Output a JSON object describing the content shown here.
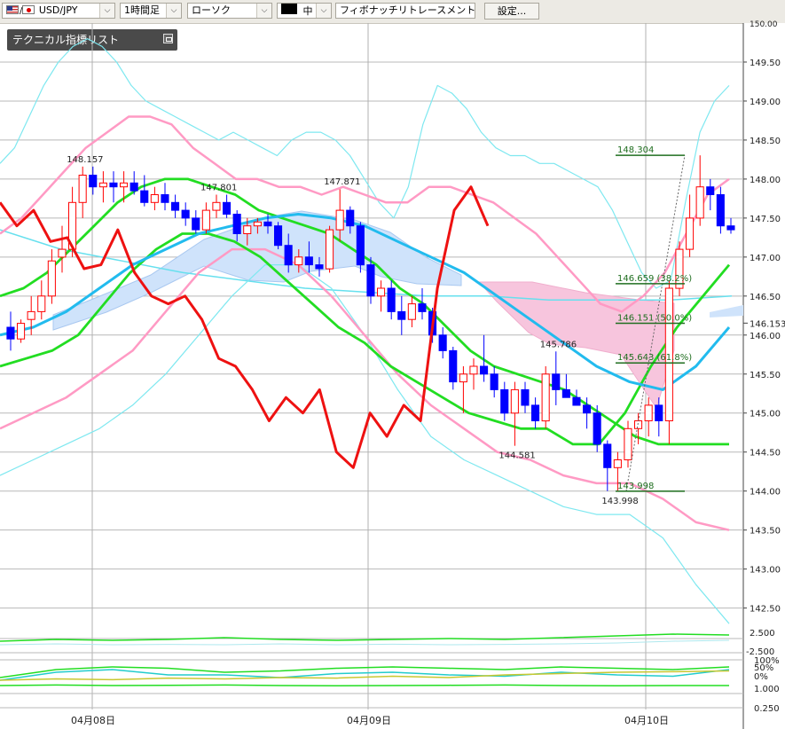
{
  "toolbar": {
    "symbol": "USD/JPY",
    "timeframe": "1時間足",
    "chart_style": "ローソク",
    "draw_tool_icon": "kaku-icon",
    "draw_size": "中",
    "drawing_tool": "フィボナッチリトレースメント",
    "settings_label": "設定..."
  },
  "indicator_panel": {
    "label": "テクニカル指標リスト"
  },
  "chart_data": [
    {
      "type": "candlestick",
      "main": true,
      "ylim": [
        142.2,
        150.0
      ],
      "y_ticks": [
        142.5,
        143.0,
        143.5,
        144.0,
        144.5,
        145.0,
        145.5,
        146.0,
        146.5,
        147.0,
        147.5,
        148.0,
        148.5,
        149.0,
        149.5
      ],
      "y_tick_labels": [
        "142.50",
        "143.00",
        "143.50",
        "144.00",
        "144.50",
        "145.00",
        "145.50",
        "146.00",
        "146.50",
        "147.00",
        "147.50",
        "148.00",
        "148.50",
        "149.00",
        "149.50"
      ],
      "top_label": "150.00",
      "x_labels": [
        "04月08日",
        "04月09日",
        "04月10日"
      ],
      "grid": true,
      "current_price_label": "146.153",
      "current_price": 146.153,
      "colors": {
        "up": "#ff0000",
        "down": "#0000ff",
        "up_fill": "#ffffff",
        "down_fill": "#0000ff"
      },
      "candles": [
        [
          146.1,
          146.3,
          145.8,
          145.95
        ],
        [
          145.95,
          146.2,
          145.9,
          146.15
        ],
        [
          146.2,
          146.5,
          146.0,
          146.3
        ],
        [
          146.3,
          146.7,
          146.2,
          146.5
        ],
        [
          146.5,
          147.1,
          146.4,
          146.95
        ],
        [
          147.0,
          147.4,
          146.8,
          147.1
        ],
        [
          147.1,
          147.9,
          147.0,
          147.7
        ],
        [
          147.7,
          148.16,
          147.5,
          148.05
        ],
        [
          148.05,
          148.16,
          147.8,
          147.9
        ],
        [
          147.9,
          148.1,
          147.7,
          147.95
        ],
        [
          147.95,
          148.1,
          147.7,
          147.9
        ],
        [
          147.9,
          148.1,
          147.7,
          147.95
        ],
        [
          147.95,
          148.1,
          147.8,
          147.85
        ],
        [
          147.85,
          148.05,
          147.65,
          147.7
        ],
        [
          147.7,
          147.9,
          147.6,
          147.8
        ],
        [
          147.8,
          147.95,
          147.6,
          147.7
        ],
        [
          147.7,
          147.8,
          147.5,
          147.6
        ],
        [
          147.6,
          147.7,
          147.4,
          147.5
        ],
        [
          147.5,
          147.6,
          147.3,
          147.35
        ],
        [
          147.35,
          147.7,
          147.3,
          147.6
        ],
        [
          147.6,
          147.8,
          147.5,
          147.7
        ],
        [
          147.7,
          147.8,
          147.5,
          147.55
        ],
        [
          147.55,
          147.6,
          147.2,
          147.3
        ],
        [
          147.3,
          147.5,
          147.15,
          147.4
        ],
        [
          147.4,
          147.5,
          147.3,
          147.45
        ],
        [
          147.45,
          147.55,
          147.3,
          147.4
        ],
        [
          147.4,
          147.45,
          147.1,
          147.15
        ],
        [
          147.15,
          147.3,
          146.8,
          146.9
        ],
        [
          146.9,
          147.1,
          146.8,
          147.0
        ],
        [
          147.0,
          147.2,
          146.8,
          146.9
        ],
        [
          146.9,
          147.0,
          146.75,
          146.85
        ],
        [
          146.85,
          147.4,
          146.8,
          147.35
        ],
        [
          147.35,
          147.87,
          147.2,
          147.6
        ],
        [
          147.6,
          147.65,
          147.3,
          147.4
        ],
        [
          147.4,
          147.45,
          146.8,
          146.9
        ],
        [
          146.9,
          147.0,
          146.4,
          146.5
        ],
        [
          146.5,
          146.7,
          146.3,
          146.6
        ],
        [
          146.6,
          146.7,
          146.2,
          146.3
        ],
        [
          146.3,
          146.5,
          146.0,
          146.2
        ],
        [
          146.2,
          146.5,
          146.1,
          146.4
        ],
        [
          146.4,
          146.6,
          146.2,
          146.3
        ],
        [
          146.3,
          146.35,
          145.9,
          146.0
        ],
        [
          146.0,
          146.1,
          145.7,
          145.8
        ],
        [
          145.8,
          145.85,
          145.3,
          145.4
        ],
        [
          145.4,
          145.6,
          145.0,
          145.5
        ],
        [
          145.5,
          145.7,
          145.3,
          145.6
        ],
        [
          145.6,
          146.0,
          145.4,
          145.5
        ],
        [
          145.5,
          145.6,
          145.2,
          145.3
        ],
        [
          145.3,
          145.4,
          144.9,
          145.0
        ],
        [
          145.0,
          145.4,
          144.58,
          145.3
        ],
        [
          145.3,
          145.4,
          145.0,
          145.1
        ],
        [
          145.1,
          145.2,
          144.8,
          144.9
        ],
        [
          144.9,
          145.6,
          144.8,
          145.5
        ],
        [
          145.5,
          145.79,
          145.1,
          145.3
        ],
        [
          145.3,
          145.5,
          145.2,
          145.2
        ],
        [
          145.2,
          145.3,
          145.1,
          145.1
        ],
        [
          145.1,
          145.2,
          144.8,
          145.0
        ],
        [
          145.0,
          145.1,
          144.5,
          144.6
        ],
        [
          144.6,
          144.65,
          144.0,
          144.3
        ],
        [
          144.3,
          144.5,
          144.0,
          144.4
        ],
        [
          144.4,
          144.9,
          144.3,
          144.8
        ],
        [
          144.8,
          145.0,
          144.6,
          144.9
        ],
        [
          144.9,
          145.2,
          144.7,
          145.1
        ],
        [
          145.1,
          145.2,
          144.7,
          144.9
        ],
        [
          144.9,
          146.7,
          144.6,
          146.6
        ],
        [
          146.6,
          147.2,
          146.5,
          147.1
        ],
        [
          147.1,
          147.8,
          147.0,
          147.5
        ],
        [
          147.5,
          148.304,
          147.4,
          147.9
        ],
        [
          147.9,
          148.0,
          147.6,
          147.8
        ],
        [
          147.8,
          147.9,
          147.3,
          147.4
        ],
        [
          147.4,
          147.5,
          147.3,
          147.35
        ]
      ],
      "fib_levels": [
        {
          "label": "148.304",
          "value": 148.304
        },
        {
          "label": "146.659 (38.2%)",
          "value": 146.659
        },
        {
          "label": "146.151 (50.0%)",
          "value": 146.151
        },
        {
          "label": "145.643 (61.8%)",
          "value": 145.643
        },
        {
          "label": "143.998",
          "value": 143.998
        }
      ],
      "annotations": [
        {
          "text": "148.157",
          "value": 148.157,
          "index": 7
        },
        {
          "text": "147.801",
          "value": 147.801,
          "index": 20
        },
        {
          "text": "147.871",
          "value": 147.871,
          "index": 32
        },
        {
          "text": "145.786",
          "value": 145.786,
          "index": 53
        },
        {
          "text": "144.581",
          "value": 144.581,
          "index": 49
        },
        {
          "text": "143.998",
          "value": 143.998,
          "index": 59
        }
      ],
      "series": [
        {
          "style": "bollinger-upper",
          "color": "#7ee8f0",
          "y": [
            148.2,
            148.4,
            148.8,
            149.2,
            149.5,
            149.7,
            149.8,
            149.7,
            149.5,
            149.2,
            149.0,
            148.9,
            148.8,
            148.7,
            148.6,
            148.5,
            148.6,
            148.5,
            148.4,
            148.3,
            148.5,
            148.6,
            148.6,
            148.5,
            148.3,
            148.0,
            147.7,
            147.5,
            147.9,
            148.7,
            149.2,
            149.1,
            148.9,
            148.6,
            148.4,
            148.3,
            148.3,
            148.2,
            148.2,
            148.1,
            148.0,
            147.9,
            147.6,
            147.2,
            146.8,
            146.6,
            146.7,
            147.7,
            148.6,
            149.0,
            149.2
          ]
        },
        {
          "style": "bollinger-plus",
          "color": "#ff9ac4",
          "y": [
            147.3,
            147.5,
            147.8,
            148.1,
            148.4,
            148.6,
            148.8,
            148.8,
            148.7,
            148.4,
            148.2,
            148.0,
            148.0,
            147.9,
            147.9,
            147.8,
            147.9,
            147.8,
            147.7,
            147.7,
            147.9,
            147.9,
            147.8,
            147.7,
            147.5,
            147.3,
            147.0,
            146.7,
            146.4,
            146.3,
            146.5,
            146.8,
            147.3,
            147.8,
            148.0
          ]
        },
        {
          "style": "bollinger-mid-slow",
          "color": "#22dd22",
          "y": [
            146.5,
            146.6,
            146.8,
            147.1,
            147.4,
            147.7,
            147.9,
            148.0,
            148.0,
            147.9,
            147.8,
            147.6,
            147.5,
            147.4,
            147.3,
            147.1,
            146.9,
            146.6,
            146.4,
            146.1,
            145.8,
            145.6,
            145.5,
            145.4,
            145.3,
            145.1,
            144.9,
            144.7,
            144.6,
            144.6,
            144.6,
            144.6
          ]
        },
        {
          "style": "bollinger-mid-fast",
          "color": "#22dd22",
          "y": [
            145.6,
            145.7,
            145.8,
            146.0,
            146.4,
            146.8,
            147.1,
            147.3,
            147.3,
            147.2,
            147.0,
            146.7,
            146.4,
            146.1,
            145.9,
            145.6,
            145.4,
            145.2,
            145.0,
            144.9,
            144.8,
            144.8,
            144.6,
            144.6,
            145.0,
            145.6,
            146.1,
            146.5,
            146.9
          ]
        },
        {
          "style": "moving-average",
          "color": "#22bbee",
          "y": [
            146.0,
            146.1,
            146.3,
            146.6,
            146.9,
            147.1,
            147.3,
            147.4,
            147.5,
            147.55,
            147.5,
            147.4,
            147.2,
            147.0,
            146.8,
            146.5,
            146.2,
            145.9,
            145.6,
            145.4,
            145.3,
            145.6,
            146.1
          ]
        },
        {
          "style": "bollinger-minus",
          "color": "#ff9ac4",
          "y": [
            144.8,
            145.0,
            145.2,
            145.5,
            145.8,
            146.3,
            146.8,
            147.1,
            147.1,
            146.9,
            146.5,
            146.0,
            145.5,
            145.1,
            144.8,
            144.5,
            144.4,
            144.2,
            144.1,
            144.1,
            143.9,
            143.6,
            143.5
          ]
        },
        {
          "style": "bollinger-lower",
          "color": "#7ee8f0",
          "y": [
            144.2,
            144.4,
            144.6,
            144.8,
            145.1,
            145.5,
            146.0,
            146.5,
            146.9,
            146.9,
            146.6,
            146.0,
            145.3,
            144.7,
            144.4,
            144.2,
            144.0,
            143.8,
            143.7,
            143.7,
            143.4,
            142.8,
            142.3
          ]
        },
        {
          "style": "oscillator",
          "color": "#ee1111",
          "y": [
            147.7,
            147.4,
            147.6,
            147.2,
            147.25,
            146.85,
            146.9,
            147.35,
            146.8,
            146.5,
            146.4,
            146.5,
            146.2,
            145.7,
            145.6,
            145.3,
            144.9,
            145.2,
            145.0,
            145.3,
            144.5,
            144.3,
            145.0,
            144.7,
            145.1,
            144.9,
            146.6,
            147.6,
            147.9,
            147.4
          ]
        }
      ]
    },
    {
      "type": "line",
      "main": false,
      "y_tick_labels": [
        "2.500",
        "-2.500"
      ],
      "series": [
        {
          "color": "#22dd22",
          "y": [
            0.5,
            0.6,
            0.55,
            0.6,
            0.7,
            0.6,
            0.55,
            0.6,
            0.65,
            0.6,
            0.7,
            0.8,
            0.9,
            0.85
          ]
        },
        {
          "color": "#aee8ee",
          "y": [
            0.3,
            0.35,
            0.3,
            0.32,
            0.3,
            0.35,
            0.3,
            0.33,
            0.3,
            0.32,
            0.35,
            0.4,
            0.5,
            0.55
          ]
        }
      ]
    },
    {
      "type": "line",
      "main": false,
      "y_tick_labels": [
        "100%",
        "50%",
        "0%",
        "1.000",
        "0.250"
      ],
      "series": [
        {
          "color": "#22dd22",
          "y": [
            0.4,
            0.7,
            0.8,
            0.75,
            0.6,
            0.65,
            0.75,
            0.8,
            0.75,
            0.7,
            0.8,
            0.75,
            0.7,
            0.8
          ]
        },
        {
          "color": "#22cccc",
          "y": [
            0.3,
            0.6,
            0.7,
            0.5,
            0.5,
            0.4,
            0.55,
            0.6,
            0.5,
            0.45,
            0.6,
            0.5,
            0.45,
            0.7
          ]
        },
        {
          "color": "#c8c830",
          "y": [
            0.3,
            0.35,
            0.32,
            0.38,
            0.35,
            0.4,
            0.38,
            0.45,
            0.4,
            0.5,
            0.55,
            0.6,
            0.62,
            0.65
          ]
        },
        {
          "color": "#22dd22",
          "y": [
            0.1,
            0.12,
            0.1,
            0.11,
            0.12,
            0.1,
            0.09,
            0.1,
            0.11,
            0.12,
            0.1,
            0.09,
            0.1,
            0.1
          ]
        }
      ]
    }
  ]
}
